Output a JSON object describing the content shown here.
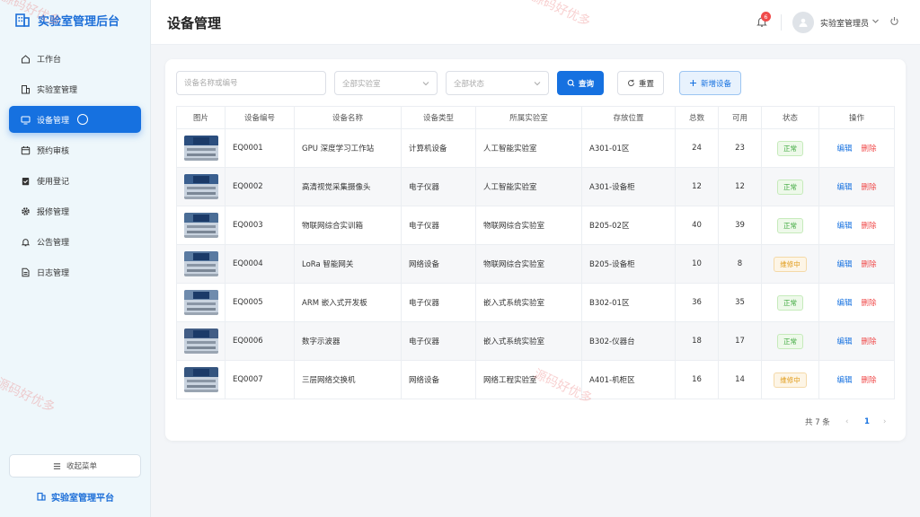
{
  "app": {
    "brand": "实验室管理后台",
    "platform_label": "实验室管理平台",
    "collapse_label": "收起菜单",
    "accent": "#1671e0"
  },
  "sidebar": {
    "items": [
      {
        "label": "工作台",
        "icon": "home-icon"
      },
      {
        "label": "实验室管理",
        "icon": "building-icon"
      },
      {
        "label": "设备管理",
        "icon": "monitor-icon",
        "active": true
      },
      {
        "label": "预约审核",
        "icon": "calendar-icon"
      },
      {
        "label": "使用登记",
        "icon": "clipboard-check-icon"
      },
      {
        "label": "报修管理",
        "icon": "gear-icon"
      },
      {
        "label": "公告管理",
        "icon": "bell-icon"
      },
      {
        "label": "日志管理",
        "icon": "document-icon"
      }
    ]
  },
  "header": {
    "title": "设备管理",
    "notification_count": "6",
    "username": "实验室管理员"
  },
  "filters": {
    "search_placeholder": "设备名称或编号",
    "lab_select": "全部实验室",
    "status_select": "全部状态",
    "query_label": "查询",
    "reset_label": "重置",
    "add_label": "新增设备"
  },
  "table": {
    "columns": [
      "图片",
      "设备编号",
      "设备名称",
      "设备类型",
      "所属实验室",
      "存放位置",
      "总数",
      "可用",
      "状态",
      "操作"
    ],
    "edit_label": "编辑",
    "delete_label": "删除",
    "rows": [
      {
        "code": "EQ0001",
        "name": "GPU 深度学习工作站",
        "type": "计算机设备",
        "lab": "人工智能实验室",
        "location": "A301-01区",
        "total": "24",
        "available": "23",
        "status": "正常",
        "status_kind": "ok"
      },
      {
        "code": "EQ0002",
        "name": "高清视觉采集摄像头",
        "type": "电子仪器",
        "lab": "人工智能实验室",
        "location": "A301-设备柜",
        "total": "12",
        "available": "12",
        "status": "正常",
        "status_kind": "ok"
      },
      {
        "code": "EQ0003",
        "name": "物联网综合实训箱",
        "type": "电子仪器",
        "lab": "物联网综合实验室",
        "location": "B205-02区",
        "total": "40",
        "available": "39",
        "status": "正常",
        "status_kind": "ok"
      },
      {
        "code": "EQ0004",
        "name": "LoRa 智能网关",
        "type": "网络设备",
        "lab": "物联网综合实验室",
        "location": "B205-设备柜",
        "total": "10",
        "available": "8",
        "status": "维修中",
        "status_kind": "fix"
      },
      {
        "code": "EQ0005",
        "name": "ARM 嵌入式开发板",
        "type": "电子仪器",
        "lab": "嵌入式系统实验室",
        "location": "B302-01区",
        "total": "36",
        "available": "35",
        "status": "正常",
        "status_kind": "ok"
      },
      {
        "code": "EQ0006",
        "name": "数字示波器",
        "type": "电子仪器",
        "lab": "嵌入式系统实验室",
        "location": "B302-仪器台",
        "total": "18",
        "available": "17",
        "status": "正常",
        "status_kind": "ok"
      },
      {
        "code": "EQ0007",
        "name": "三层网络交换机",
        "type": "网络设备",
        "lab": "网络工程实验室",
        "location": "A401-机柜区",
        "total": "16",
        "available": "14",
        "status": "维修中",
        "status_kind": "fix"
      }
    ]
  },
  "pagination": {
    "total_label": "共 7 条",
    "current_page": "1"
  },
  "watermark": "源码好优多"
}
